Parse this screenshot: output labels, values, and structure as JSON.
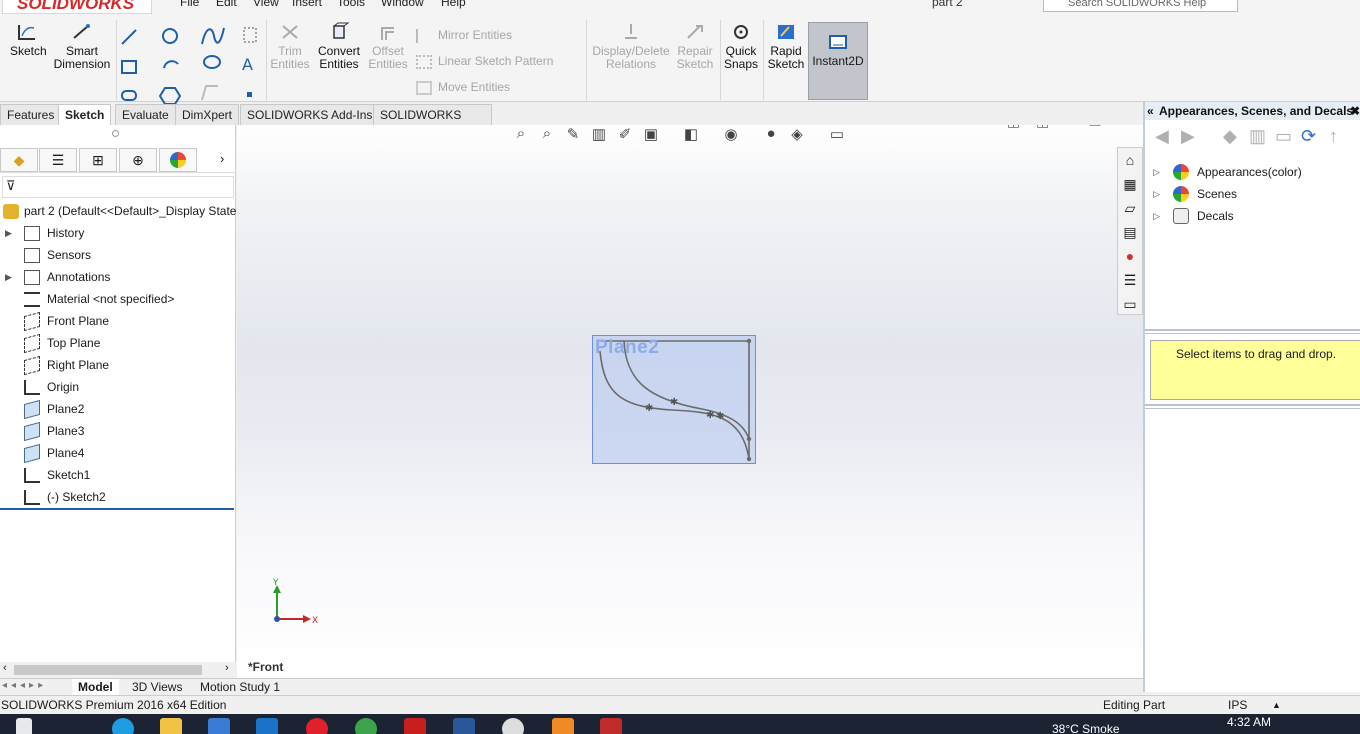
{
  "app": {
    "logo_text": "SOLIDWORKS",
    "doc_title": "part 2",
    "search_placeholder": "Search SOLIDWORKS Help"
  },
  "menu": [
    "File",
    "Edit",
    "View",
    "Insert",
    "Tools",
    "Window",
    "Help"
  ],
  "commands": {
    "sketch": "Sketch",
    "smart_dimension": [
      "Smart",
      "Dimension"
    ],
    "trim": [
      "Trim",
      "Entities"
    ],
    "convert": [
      "Convert",
      "Entities"
    ],
    "offset": [
      "Offset",
      "Entities"
    ],
    "mirror": "Mirror Entities",
    "linear_pattern": "Linear Sketch Pattern",
    "move": "Move Entities",
    "display_delete": [
      "Display/Delete",
      "Relations"
    ],
    "repair": [
      "Repair",
      "Sketch"
    ],
    "quick_snaps": [
      "Quick",
      "Snaps"
    ],
    "rapid_sketch": [
      "Rapid",
      "Sketch"
    ],
    "instant2d": "Instant2D"
  },
  "tabs": [
    "Features",
    "Sketch",
    "Evaluate",
    "DimXpert",
    "SOLIDWORKS Add-Ins",
    "SOLIDWORKS MBD"
  ],
  "tree": {
    "root": "part 2  (Default<<Default>_Display State",
    "nodes": [
      "History",
      "Sensors",
      "Annotations",
      "Material <not specified>",
      "Front Plane",
      "Top Plane",
      "Right Plane",
      "Origin",
      "Plane2",
      "Plane3",
      "Plane4",
      "Sketch1",
      "(-) Sketch2"
    ]
  },
  "viewport": {
    "plane_label": "Plane2",
    "view_name": "*Front",
    "axis_y": "Y",
    "axis_x": "X"
  },
  "taskpane": {
    "title": "Appearances, Scenes, and Decals",
    "items": [
      "Appearances(color)",
      "Scenes",
      "Decals"
    ],
    "hint": "Select items to drag and drop."
  },
  "bottom_tabs": [
    "Model",
    "3D Views",
    "Motion Study 1"
  ],
  "status": {
    "edition": "SOLIDWORKS Premium 2016 x64 Edition",
    "mode": "Editing Part",
    "units": "IPS"
  },
  "taskbar": {
    "time": "4:32 AM",
    "weather": "38°C  Smoke"
  },
  "colors": {
    "accent_red": "#d42a2a",
    "selection_blue": "#6a8ee8",
    "tooltip_yellow": "#ffff99",
    "taskbar": "#1c2433"
  }
}
